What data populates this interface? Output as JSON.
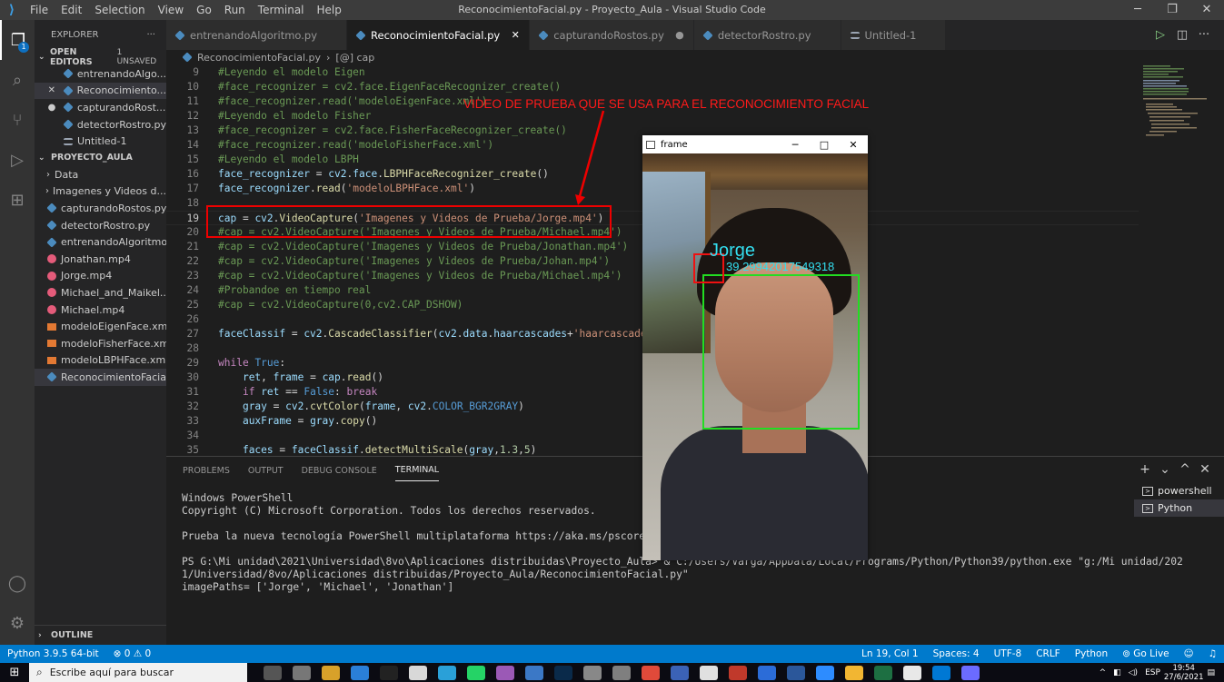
{
  "window": {
    "title": "ReconocimientoFacial.py - Proyecto_Aula - Visual Studio Code",
    "menu": [
      "File",
      "Edit",
      "Selection",
      "View",
      "Go",
      "Run",
      "Terminal",
      "Help"
    ],
    "controls": [
      "─",
      "❐",
      "✕"
    ]
  },
  "activity": {
    "badge": "1"
  },
  "sidebar": {
    "explorer_label": "EXPLORER",
    "more": "···",
    "open_editors_label": "OPEN EDITORS",
    "unsaved": "1 UNSAVED",
    "open_editors": [
      {
        "name": "entrenandoAlgo...",
        "lead": "",
        "type": "py"
      },
      {
        "name": "Reconocimiento...",
        "lead": "✕",
        "type": "py"
      },
      {
        "name": "capturandoRost...",
        "lead": "●",
        "type": "py"
      },
      {
        "name": "detectorRostro.py",
        "lead": "",
        "type": "py"
      },
      {
        "name": "Untitled-1",
        "lead": "",
        "type": "txt"
      }
    ],
    "project_label": "PROYECTO_AULA",
    "files": [
      {
        "name": "Data",
        "type": "folder"
      },
      {
        "name": "Imagenes y Videos d...",
        "type": "folder"
      },
      {
        "name": "capturandoRostos.py",
        "type": "py"
      },
      {
        "name": "detectorRostro.py",
        "type": "py"
      },
      {
        "name": "entrenandoAlgoritmo...",
        "type": "py"
      },
      {
        "name": "Jonathan.mp4",
        "type": "mp4"
      },
      {
        "name": "Jorge.mp4",
        "type": "mp4"
      },
      {
        "name": "Michael_and_Maikel....",
        "type": "mp4"
      },
      {
        "name": "Michael.mp4",
        "type": "mp4"
      },
      {
        "name": "modeloEigenFace.xml",
        "type": "xml"
      },
      {
        "name": "modeloFisherFace.xml",
        "type": "xml"
      },
      {
        "name": "modeloLBPHFace.xml",
        "type": "xml"
      },
      {
        "name": "ReconocimientoFacial...",
        "type": "py"
      }
    ],
    "outline_label": "OUTLINE"
  },
  "tabs": [
    {
      "label": "entrenandoAlgoritmo.py",
      "close": "",
      "active": false
    },
    {
      "label": "ReconocimientoFacial.py",
      "close": "✕",
      "active": true
    },
    {
      "label": "capturandoRostos.py",
      "close": "●",
      "active": false
    },
    {
      "label": "detectorRostro.py",
      "close": "",
      "active": false
    },
    {
      "label": "Untitled-1",
      "close": "",
      "active": false
    }
  ],
  "breadcrumb": {
    "file": "ReconocimientoFacial.py",
    "sep": "›",
    "symbol": "[@] cap"
  },
  "editor": {
    "lines": [
      {
        "n": "9",
        "segs": [
          [
            "com",
            "#Leyendo el modelo Eigen"
          ]
        ]
      },
      {
        "n": "10",
        "segs": [
          [
            "com",
            "#face_recognizer = cv2.face.EigenFaceRecognizer_create()"
          ]
        ]
      },
      {
        "n": "11",
        "segs": [
          [
            "com",
            "#face_recognizer.read('modeloEigenFace.xml')"
          ]
        ]
      },
      {
        "n": "12",
        "segs": [
          [
            "com",
            "#Leyendo el modelo Fisher"
          ]
        ]
      },
      {
        "n": "13",
        "segs": [
          [
            "com",
            "#face_recognizer = cv2.face.FisherFaceRecognizer_create()"
          ]
        ]
      },
      {
        "n": "14",
        "segs": [
          [
            "com",
            "#face_recognizer.read('modeloFisherFace.xml')"
          ]
        ]
      },
      {
        "n": "15",
        "segs": [
          [
            "com",
            "#Leyendo el modelo LBPH"
          ]
        ]
      },
      {
        "n": "16",
        "segs": [
          [
            "var",
            "face_recognizer"
          ],
          [
            "op",
            " = "
          ],
          [
            "var",
            "cv2"
          ],
          [
            "pl",
            "."
          ],
          [
            "var",
            "face"
          ],
          [
            "pl",
            "."
          ],
          [
            "fn",
            "LBPHFaceRecognizer_create"
          ],
          [
            "pl",
            "()"
          ]
        ]
      },
      {
        "n": "17",
        "segs": [
          [
            "var",
            "face_recognizer"
          ],
          [
            "pl",
            "."
          ],
          [
            "fn",
            "read"
          ],
          [
            "pl",
            "("
          ],
          [
            "str",
            "'modeloLBPHFace.xml'"
          ],
          [
            "pl",
            ")"
          ]
        ]
      },
      {
        "n": "18",
        "segs": []
      },
      {
        "n": "19",
        "segs": [
          [
            "var",
            "cap"
          ],
          [
            "op",
            " = "
          ],
          [
            "var",
            "cv2"
          ],
          [
            "pl",
            "."
          ],
          [
            "fn",
            "VideoCapture"
          ],
          [
            "pl",
            "("
          ],
          [
            "str",
            "'Imagenes y Videos de Prueba/Jorge.mp4'"
          ],
          [
            "pl",
            ")"
          ]
        ],
        "current": true
      },
      {
        "n": "20",
        "segs": [
          [
            "com",
            "#cap = cv2.VideoCapture('Imagenes y Videos de Prueba/Michael.mp4')"
          ]
        ]
      },
      {
        "n": "21",
        "segs": [
          [
            "com",
            "#cap = cv2.VideoCapture('Imagenes y Videos de Prueba/Jonathan.mp4')"
          ]
        ]
      },
      {
        "n": "22",
        "segs": [
          [
            "com",
            "#cap = cv2.VideoCapture('Imagenes y Videos de Prueba/Johan.mp4')"
          ]
        ]
      },
      {
        "n": "23",
        "segs": [
          [
            "com",
            "#cap = cv2.VideoCapture('Imagenes y Videos de Prueba/Michael.mp4')"
          ]
        ]
      },
      {
        "n": "24",
        "segs": [
          [
            "com",
            "#Probandoe en tiempo real"
          ]
        ]
      },
      {
        "n": "25",
        "segs": [
          [
            "com",
            "#cap = cv2.VideoCapture(0,cv2.CAP_DSHOW)"
          ]
        ]
      },
      {
        "n": "26",
        "segs": []
      },
      {
        "n": "27",
        "segs": [
          [
            "var",
            "faceClassif"
          ],
          [
            "op",
            " = "
          ],
          [
            "var",
            "cv2"
          ],
          [
            "pl",
            "."
          ],
          [
            "fn",
            "CascadeClassifier"
          ],
          [
            "pl",
            "("
          ],
          [
            "var",
            "cv2"
          ],
          [
            "pl",
            "."
          ],
          [
            "var",
            "data"
          ],
          [
            "pl",
            "."
          ],
          [
            "var",
            "haarcascades"
          ],
          [
            "op",
            "+"
          ],
          [
            "str",
            "'haarcascade_f"
          ]
        ]
      },
      {
        "n": "28",
        "segs": []
      },
      {
        "n": "29",
        "segs": [
          [
            "kw",
            "while"
          ],
          [
            "pl",
            " "
          ],
          [
            "blue",
            "True"
          ],
          [
            "pl",
            ":"
          ]
        ]
      },
      {
        "n": "30",
        "segs": [
          [
            "pl",
            "    "
          ],
          [
            "var",
            "ret"
          ],
          [
            "pl",
            ", "
          ],
          [
            "var",
            "frame"
          ],
          [
            "op",
            " = "
          ],
          [
            "var",
            "cap"
          ],
          [
            "pl",
            "."
          ],
          [
            "fn",
            "read"
          ],
          [
            "pl",
            "()"
          ]
        ]
      },
      {
        "n": "31",
        "segs": [
          [
            "pl",
            "    "
          ],
          [
            "kw",
            "if"
          ],
          [
            "pl",
            " "
          ],
          [
            "var",
            "ret"
          ],
          [
            "op",
            " == "
          ],
          [
            "blue",
            "False"
          ],
          [
            "pl",
            ": "
          ],
          [
            "kw",
            "break"
          ]
        ]
      },
      {
        "n": "32",
        "segs": [
          [
            "pl",
            "    "
          ],
          [
            "var",
            "gray"
          ],
          [
            "op",
            " = "
          ],
          [
            "var",
            "cv2"
          ],
          [
            "pl",
            "."
          ],
          [
            "fn",
            "cvtColor"
          ],
          [
            "pl",
            "("
          ],
          [
            "var",
            "frame"
          ],
          [
            "pl",
            ", "
          ],
          [
            "var",
            "cv2"
          ],
          [
            "pl",
            "."
          ],
          [
            "blue",
            "COLOR_BGR2GRAY"
          ],
          [
            "pl",
            ")"
          ]
        ]
      },
      {
        "n": "33",
        "segs": [
          [
            "pl",
            "    "
          ],
          [
            "var",
            "auxFrame"
          ],
          [
            "op",
            " = "
          ],
          [
            "var",
            "gray"
          ],
          [
            "pl",
            "."
          ],
          [
            "fn",
            "copy"
          ],
          [
            "pl",
            "()"
          ]
        ]
      },
      {
        "n": "34",
        "segs": []
      },
      {
        "n": "35",
        "segs": [
          [
            "pl",
            "    "
          ],
          [
            "var",
            "faces"
          ],
          [
            "op",
            " = "
          ],
          [
            "var",
            "faceClassif"
          ],
          [
            "pl",
            "."
          ],
          [
            "fn",
            "detectMultiScale"
          ],
          [
            "pl",
            "("
          ],
          [
            "var",
            "gray"
          ],
          [
            "pl",
            ","
          ],
          [
            "num",
            "1.3"
          ],
          [
            "pl",
            ","
          ],
          [
            "num",
            "5"
          ],
          [
            "pl",
            ")"
          ]
        ]
      }
    ]
  },
  "annotation": "VIDEO DE PRUEBA QUE SE USA PARA EL RECONOCIMIENTO FACIAL",
  "panel": {
    "tabs": [
      "PROBLEMS",
      "OUTPUT",
      "DEBUG CONSOLE",
      "TERMINAL"
    ],
    "active_tab": "TERMINAL",
    "actions": [
      "+",
      "⌄",
      "^",
      "✕"
    ],
    "terminal_text": "Windows PowerShell\nCopyright (C) Microsoft Corporation. Todos los derechos reservados.\n\nPrueba la nueva tecnología PowerShell multiplataforma https://aka.ms/pscore6\n\nPS G:\\Mi unidad\\2021\\Universidad\\8vo\\Aplicaciones distribuidas\\Proyecto_Aula> & C:/Users/Varga/AppData/Local/Programs/Python/Python39/python.exe \"g:/Mi unidad/202\n1/Universidad/8vo/Aplicaciones distribuidas/Proyecto_Aula/ReconocimientoFacial.py\"\nimagePaths= ['Jorge', 'Michael', 'Jonathan']",
    "terminals": [
      "powershell",
      "Python"
    ]
  },
  "cv_window": {
    "title": "frame",
    "label": "Jorge",
    "confidence": "39.29942017549318"
  },
  "status": {
    "python": "Python 3.9.5 64-bit",
    "problems": "⊗ 0 ⚠ 0",
    "position": "Ln 19, Col 1",
    "spaces": "Spaces: 4",
    "encoding": "UTF-8",
    "eol": "CRLF",
    "language": "Python",
    "golive": "⊚ Go Live"
  },
  "taskbar": {
    "search_placeholder": "Escribe aquí para buscar",
    "lang": "ESP",
    "time": "19:54",
    "date": "27/6/2021"
  }
}
